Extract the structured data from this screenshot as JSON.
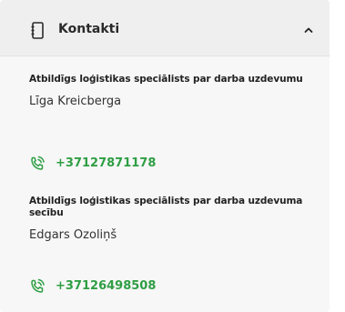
{
  "panel": {
    "title": "Kontakti",
    "accent_color": "#2f9e44",
    "header_icon": "notebook-icon",
    "toggle_icon": "chevron-up-icon"
  },
  "contacts": [
    {
      "role": "Atbildīgs loģistikas speciālists par darba uzdevumu",
      "name": "Līga Kreicberga",
      "phone": "+37127871178",
      "phone_icon": "phone-call-icon"
    },
    {
      "role": "Atbildīgs loģistikas speciālists par darba uzdevuma secību",
      "name": "Edgars Ozoliņš",
      "phone": "+37126498508",
      "phone_icon": "phone-call-icon"
    }
  ]
}
